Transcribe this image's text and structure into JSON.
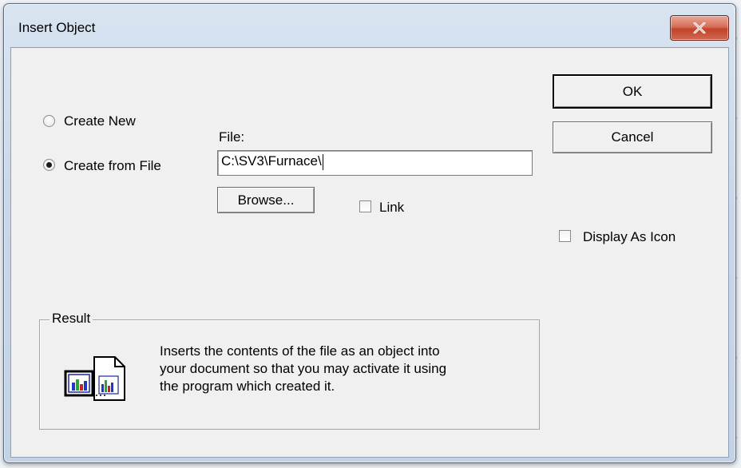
{
  "window": {
    "title": "Insert Object"
  },
  "options": {
    "create_new": "Create New",
    "create_from_file": "Create from File",
    "selected": "create_from_file"
  },
  "file": {
    "label": "File:",
    "value": "C:\\SV3\\Furnace\\"
  },
  "buttons": {
    "browse": "Browse...",
    "ok": "OK",
    "cancel": "Cancel"
  },
  "checkboxes": {
    "link": "Link",
    "display_as_icon": "Display As Icon"
  },
  "result": {
    "legend": "Result",
    "line1": "Inserts the contents of the file as an object into",
    "line2": "your document so that you may activate it using",
    "line3": "the program which created it."
  },
  "icons": {
    "close": "close-icon",
    "result": "file-object-icon"
  }
}
